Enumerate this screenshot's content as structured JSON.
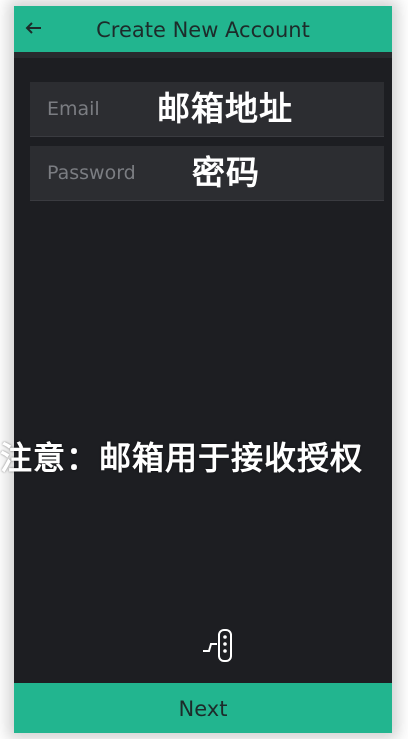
{
  "header": {
    "title": "Create New Account",
    "back_icon": "back-arrow-icon"
  },
  "form": {
    "email": {
      "placeholder": "Email",
      "overlay_text": "邮箱地址"
    },
    "password": {
      "placeholder": "Password",
      "overlay_text": "密码"
    }
  },
  "note": {
    "text": "注意：邮箱用于接收授权"
  },
  "logo": {
    "icon": "blynk-logo-icon"
  },
  "footer": {
    "next_label": "Next"
  },
  "colors": {
    "accent": "#22b58f",
    "background": "#1d1e22",
    "field_background": "#2c2d31",
    "placeholder": "#7b7d82",
    "text_dark": "#1d2b2a",
    "text_light": "#ffffff"
  }
}
